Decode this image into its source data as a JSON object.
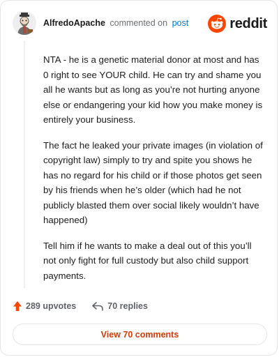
{
  "comment": {
    "username": "AlfredoApache",
    "verb": "commented on",
    "target": "post",
    "paragraphs": [
      "NTA - he is a genetic material donor at most and has 0 right to see YOUR child. He can try and shame you all he wants but as long as you’re not hurting anyone else or endangering your kid how you make money is entirely your business.",
      "The fact he leaked your private images (in violation of copyright law) simply to try and spite you shows he has no regard for his child or if those photos get seen by his friends when he’s older (which had he not publicly blasted them over social likely wouldn’t have happened)",
      "Tell him if he wants to make a deal out of this you’ll not only fight for full custody but also child support payments."
    ]
  },
  "brand": {
    "name": "reddit",
    "icon": "reddit-snoo-icon",
    "color": "#ff4500"
  },
  "actions": {
    "upvotes": "289 upvotes",
    "replies": "70 replies",
    "upvote_icon": "upvote-arrow-icon",
    "reply_icon": "reply-arrow-icon",
    "upvote_color": "#ff4500"
  },
  "footer": {
    "view_button": "View 70 comments",
    "accent": "#d93a00"
  }
}
